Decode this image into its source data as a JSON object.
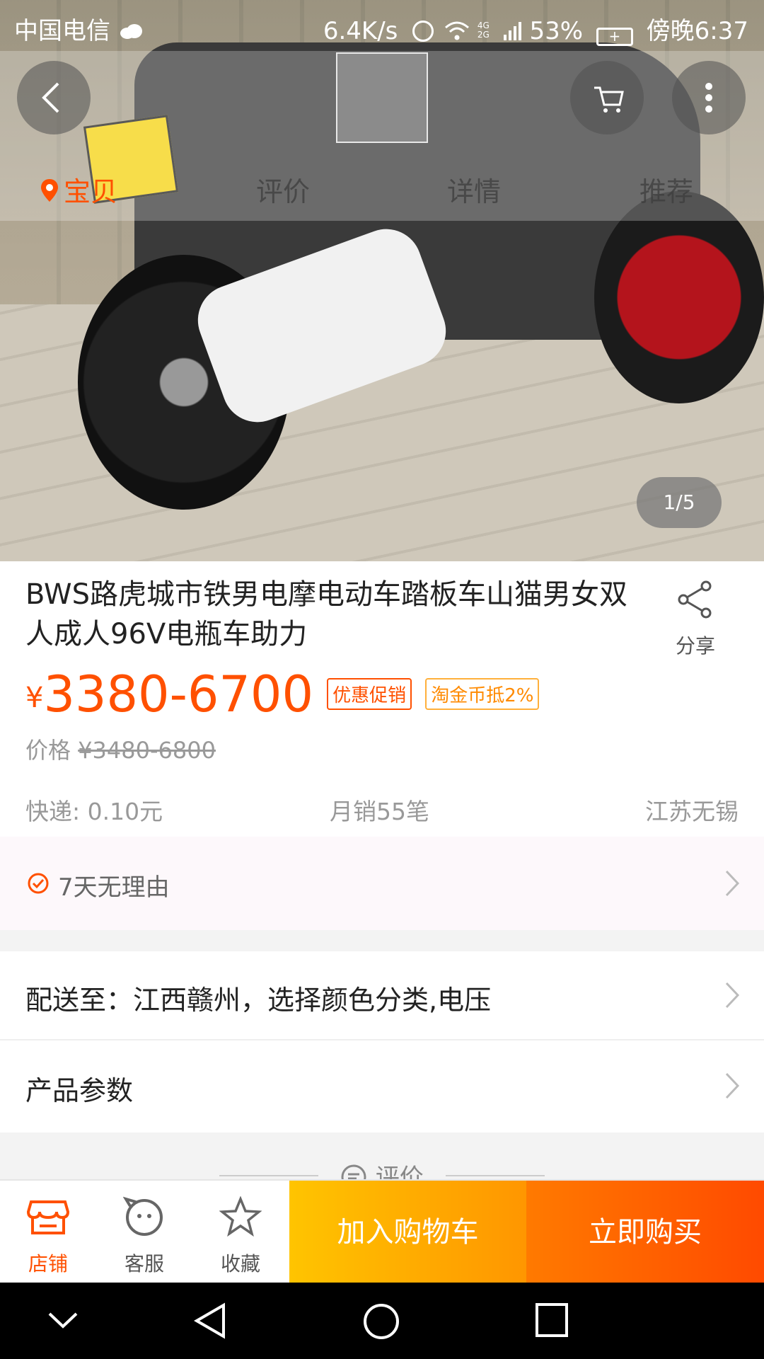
{
  "status_bar": {
    "carrier": "中国电信",
    "net_speed": "6.4K/s",
    "network": "4G 2G",
    "battery": "53%",
    "time": "傍晚6:37"
  },
  "tabs": [
    {
      "label": "宝贝"
    },
    {
      "label": "评价"
    },
    {
      "label": "详情"
    },
    {
      "label": "推荐"
    }
  ],
  "gallery": {
    "counter": "1/5"
  },
  "product": {
    "title": "BWS路虎城市铁男电摩电动车踏板车山猫男女双人成人96V电瓶车助力",
    "share_label": "分享",
    "currency": "¥",
    "price": "3380-6700",
    "tags": [
      "优惠促销",
      "淘金币抵2%"
    ],
    "orig_label": "价格",
    "orig_price": "¥3480-6800",
    "shipping": "快递: 0.10元",
    "monthly_sales": "月销55笔",
    "location": "江苏无锡"
  },
  "guarantee": {
    "text": "7天无理由"
  },
  "rows": {
    "delivery": "配送至：江西赣州，选择颜色分类,电压",
    "params": "产品参数"
  },
  "review_peek": "评价",
  "bottom_bar": {
    "shop": "店铺",
    "service": "客服",
    "favorite": "收藏",
    "add_cart": "加入购物车",
    "buy_now": "立即购买"
  },
  "colors": {
    "accent": "#ff5000",
    "cart_start": "#ffc400",
    "buy_end": "#ff4a00"
  }
}
